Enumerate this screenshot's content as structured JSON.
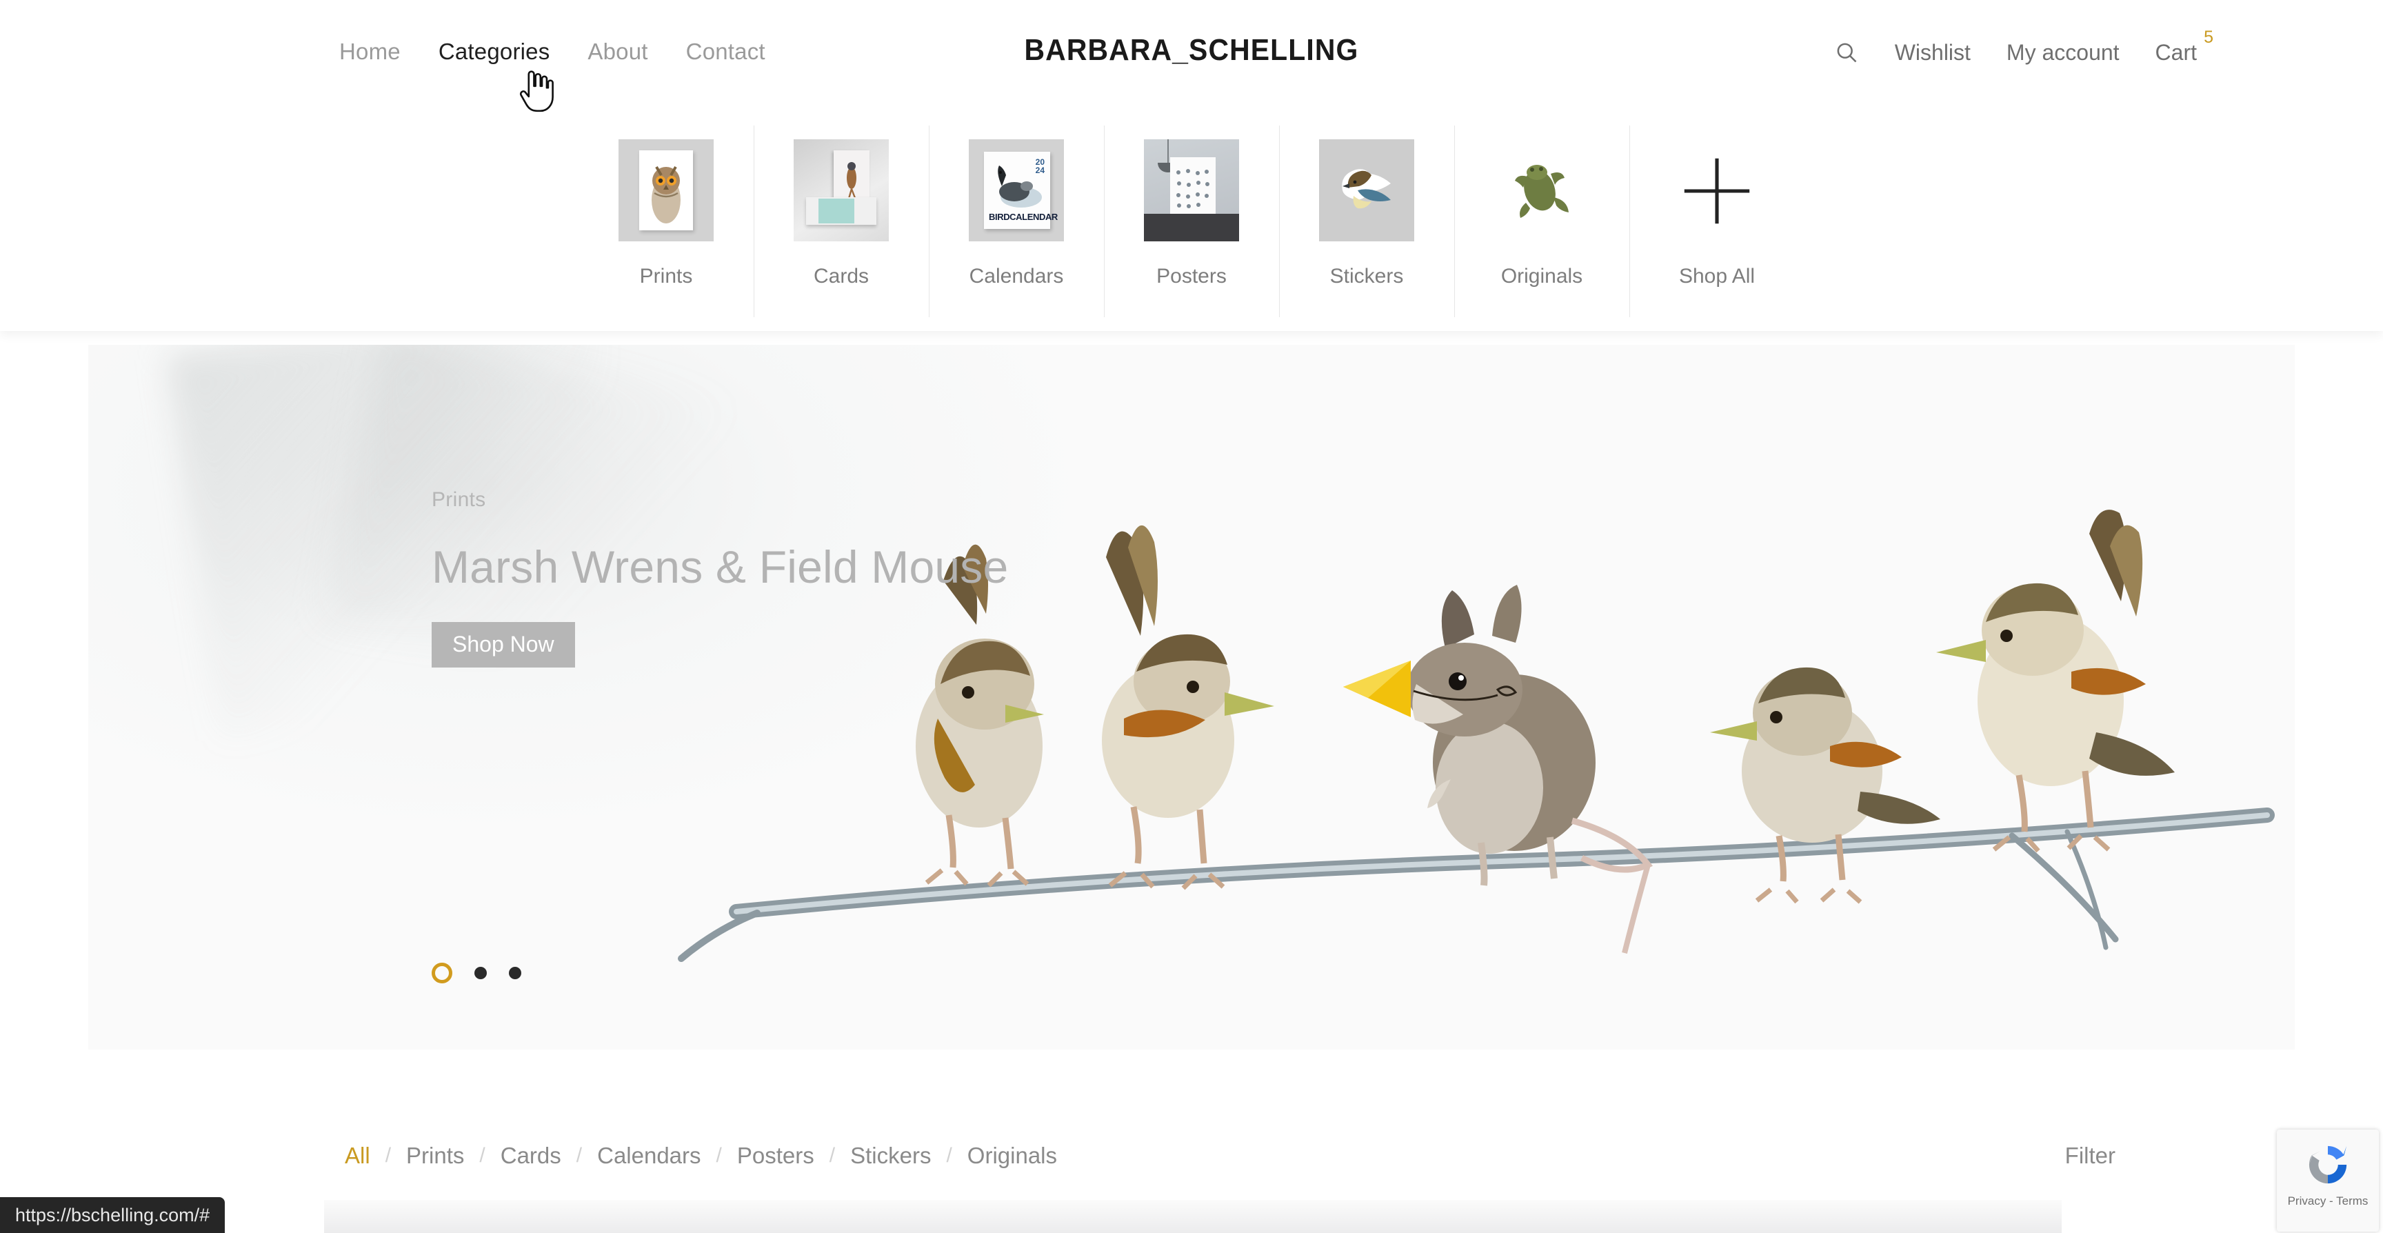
{
  "site": {
    "logo": "BARBARA_SCHELLING"
  },
  "nav": {
    "items": [
      {
        "label": "Home",
        "active": false
      },
      {
        "label": "Categories",
        "active": true
      },
      {
        "label": "About",
        "active": false
      },
      {
        "label": "Contact",
        "active": false
      }
    ]
  },
  "header_right": {
    "search_icon": "search-icon",
    "wishlist": "Wishlist",
    "account": "My account",
    "cart": "Cart",
    "cart_count": "5",
    "cart_count_color": "#c99a21"
  },
  "dropdown": {
    "items": [
      {
        "label": "Prints",
        "art": "owl-print"
      },
      {
        "label": "Cards",
        "art": "greeting-card"
      },
      {
        "label": "Calendars",
        "art": "bird-calendar",
        "calendar_title": "BIRDCALENDAR",
        "calendar_year_top": "20",
        "calendar_year_bottom": "24"
      },
      {
        "label": "Posters",
        "art": "framed-poster"
      },
      {
        "label": "Stickers",
        "art": "bird-sticker"
      },
      {
        "label": "Originals",
        "art": "frog-original"
      },
      {
        "label": "Shop All",
        "art": "plus-icon"
      }
    ]
  },
  "hero": {
    "eyebrow": "Prints",
    "title": "Marsh Wrens & Field Mouse",
    "cta": "Shop Now",
    "slides_total": 3,
    "active_slide": 1,
    "active_dot_color": "#d19b1e",
    "artwork": "marsh-wrens-and-field-mouse-illustration"
  },
  "filter_bar": {
    "separator": "/",
    "items": [
      {
        "label": "All",
        "active": true
      },
      {
        "label": "Prints",
        "active": false
      },
      {
        "label": "Cards",
        "active": false
      },
      {
        "label": "Calendars",
        "active": false
      },
      {
        "label": "Posters",
        "active": false
      },
      {
        "label": "Stickers",
        "active": false
      },
      {
        "label": "Originals",
        "active": false
      }
    ],
    "filter_label": "Filter",
    "active_color": "#c99a21"
  },
  "recaptcha": {
    "text": "Privacy - Terms"
  },
  "status_bar": {
    "url": "https://bschelling.com/#"
  }
}
